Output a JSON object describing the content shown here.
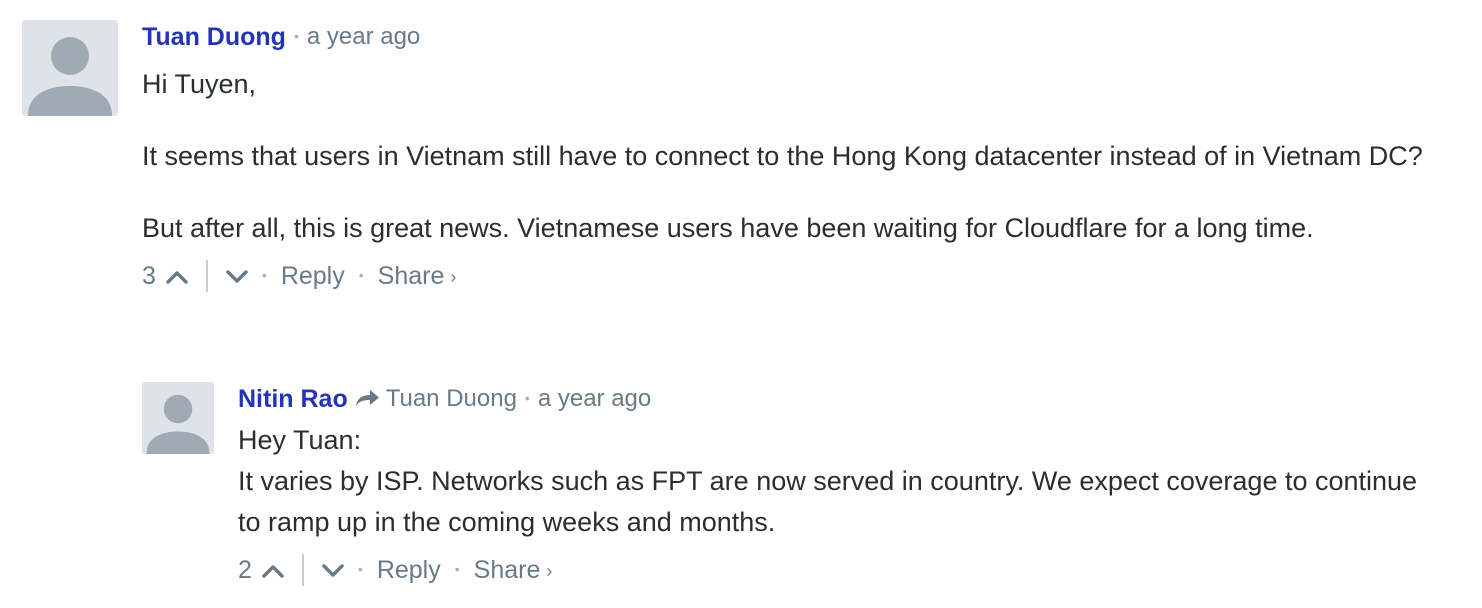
{
  "comments": [
    {
      "author": "Tuan Duong",
      "time": "a year ago",
      "paragraphs": [
        "Hi Tuyen,",
        "It seems that users in Vietnam still have to connect to the Hong Kong datacenter instead of in Vietnam DC?",
        "But after all, this is great news. Vietnamese users have been waiting for Cloudflare for a long time."
      ],
      "votes": "3",
      "reply_label": "Reply",
      "share_label": "Share",
      "share_chevron": "›"
    },
    {
      "author": "Nitin Rao",
      "in_reply_to": "Tuan Duong",
      "time": "a year ago",
      "paragraphs": [
        "Hey Tuan:",
        "It varies by ISP. Networks such as FPT are now served in country. We expect coverage to continue to ramp up in the coming weeks and months."
      ],
      "votes": "2",
      "reply_label": "Reply",
      "share_label": "Share",
      "share_chevron": "›"
    }
  ],
  "icons": {
    "upvote": "chevron-up-icon",
    "downvote": "chevron-down-icon",
    "reply_to": "reply-arrow-icon",
    "avatar": "default-avatar-icon"
  },
  "colors": {
    "author_link": "#2335b6",
    "meta_text": "#687a86",
    "body_text": "#2a2e2e",
    "avatar_bg": "#dde3e8",
    "avatar_fg": "#a0aab3"
  }
}
